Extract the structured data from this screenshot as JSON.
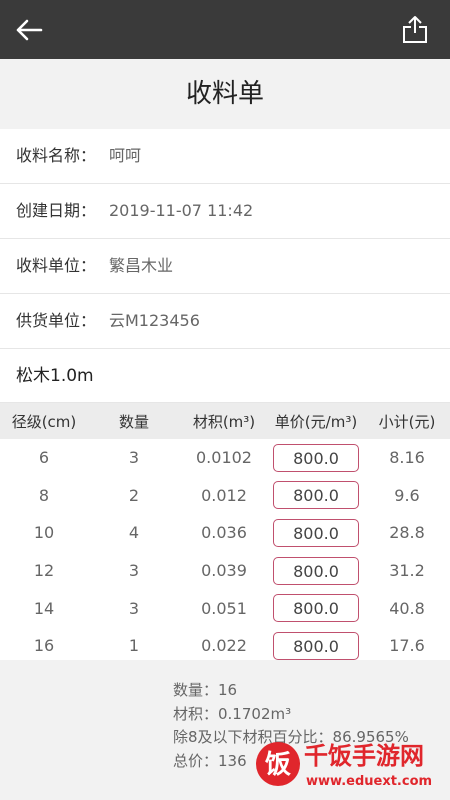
{
  "page": {
    "title": "收料单"
  },
  "info": [
    {
      "label": "收料名称：",
      "value": "呵呵"
    },
    {
      "label": "创建日期：",
      "value": "2019-11-07 11:42"
    },
    {
      "label": "收料单位：",
      "value": "繁昌木业"
    },
    {
      "label": "供货单位：",
      "value": "云M123456"
    }
  ],
  "section_title": "松木1.0m",
  "table": {
    "headers": [
      "径级(cm)",
      "数量",
      "材积(m³)",
      "单价(元/m³)",
      "小计(元)"
    ],
    "rows": [
      {
        "grade": "6",
        "qty": "3",
        "volume": "0.0102",
        "price": "800.0",
        "subtotal": "8.16"
      },
      {
        "grade": "8",
        "qty": "2",
        "volume": "0.012",
        "price": "800.0",
        "subtotal": "9.6"
      },
      {
        "grade": "10",
        "qty": "4",
        "volume": "0.036",
        "price": "800.0",
        "subtotal": "28.8"
      },
      {
        "grade": "12",
        "qty": "3",
        "volume": "0.039",
        "price": "800.0",
        "subtotal": "31.2"
      },
      {
        "grade": "14",
        "qty": "3",
        "volume": "0.051",
        "price": "800.0",
        "subtotal": "40.8"
      },
      {
        "grade": "16",
        "qty": "1",
        "volume": "0.022",
        "price": "800.0",
        "subtotal": "17.6"
      }
    ]
  },
  "summary": {
    "count": "数量：16",
    "volume": "材积：0.1702m³",
    "percent": "除8及以下材积百分比：86.9565%",
    "total": "总价：136"
  },
  "watermark": {
    "text": "千饭手游网",
    "url": "www.eduext.com"
  },
  "colors": {
    "topbar": "#3a3a3a",
    "price_border": "#c0506e",
    "watermark_red": "#e0262c"
  }
}
